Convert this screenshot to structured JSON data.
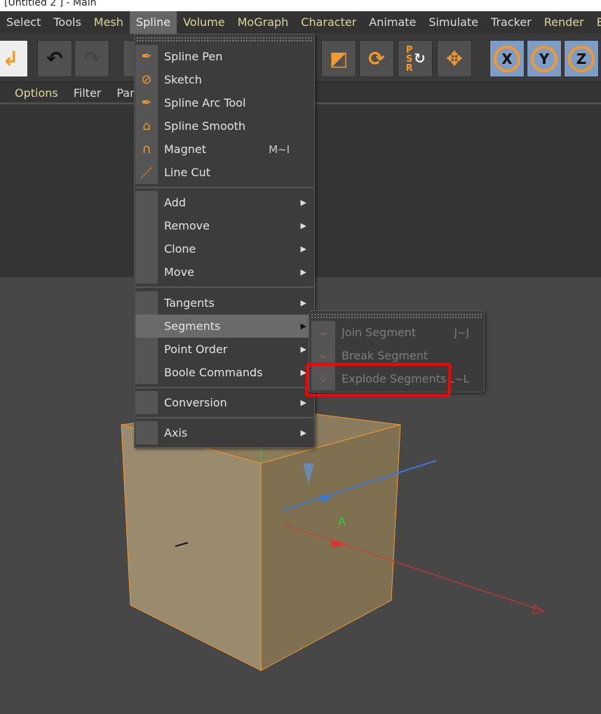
{
  "window": {
    "title": "[Untitled 2  ] - Main"
  },
  "menubar": [
    {
      "label": "Select",
      "y": false
    },
    {
      "label": "Tools",
      "y": false
    },
    {
      "label": "Mesh",
      "y": true
    },
    {
      "label": "Spline",
      "y": false,
      "active": true
    },
    {
      "label": "Volume",
      "y": true
    },
    {
      "label": "MoGraph",
      "y": true
    },
    {
      "label": "Character",
      "y": true
    },
    {
      "label": "Animate",
      "y": false
    },
    {
      "label": "Simulate",
      "y": false
    },
    {
      "label": "Tracker",
      "y": false
    },
    {
      "label": "Render",
      "y": true
    },
    {
      "label": "E",
      "y": true
    }
  ],
  "toolbar": {
    "x": "X",
    "y": "Y",
    "z": "Z",
    "psr": "PSR"
  },
  "subbar": {
    "options": "Options",
    "filter": "Filter",
    "panel": "Pan"
  },
  "spline_menu": {
    "items": [
      {
        "label": "Spline Pen",
        "icon": "pen-icon"
      },
      {
        "label": "Sketch",
        "icon": "sketch-icon"
      },
      {
        "label": "Spline Arc Tool",
        "icon": "arc-tool-icon"
      },
      {
        "label": "Spline Smooth",
        "icon": "smooth-icon"
      },
      {
        "label": "Magnet",
        "icon": "magnet-icon",
        "shortcut": "M~I"
      },
      {
        "label": "Line Cut",
        "icon": "knife-icon"
      },
      {
        "label": "Add",
        "submenu": true
      },
      {
        "label": "Remove",
        "submenu": true
      },
      {
        "label": "Clone",
        "submenu": true
      },
      {
        "label": "Move",
        "submenu": true
      },
      {
        "label": "Tangents",
        "submenu": true
      },
      {
        "label": "Segments",
        "submenu": true,
        "highlighted": true
      },
      {
        "label": "Point Order",
        "submenu": true
      },
      {
        "label": "Boole Commands",
        "submenu": true
      },
      {
        "label": "Conversion",
        "submenu": true
      },
      {
        "label": "Axis",
        "submenu": true
      }
    ]
  },
  "segments_menu": {
    "items": [
      {
        "label": "Join Segment",
        "shortcut": "J~J",
        "disabled": true
      },
      {
        "label": "Break Segment",
        "disabled": true
      },
      {
        "label": "Explode Segments",
        "shortcut": "L~L",
        "disabled": true,
        "annotated": true
      }
    ]
  },
  "colors": {
    "accent": "#f2992e",
    "annotation": "#ff0000",
    "menu_highlight": "#6a6a6a"
  }
}
